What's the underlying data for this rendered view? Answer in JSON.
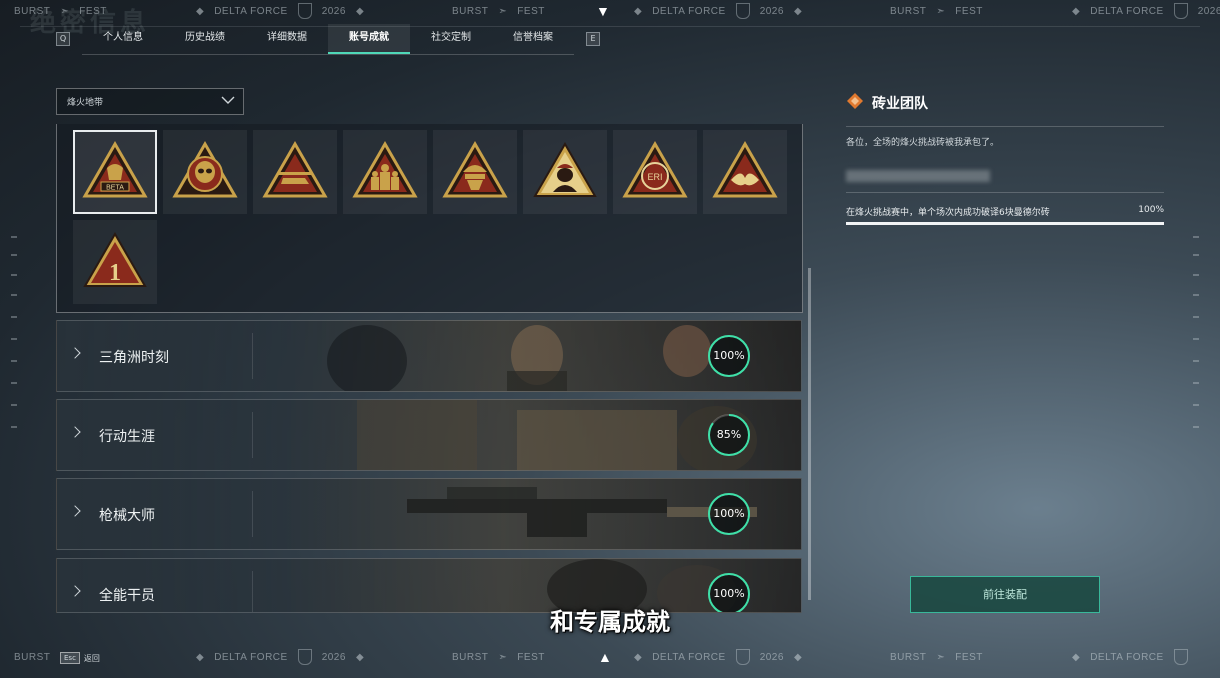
{
  "banner": {
    "burst": "BURST",
    "fest": "FEST",
    "delta_force": "DELTA FORCE",
    "year": "2026"
  },
  "watermark": "绝密信息",
  "tabs": {
    "left_key": "Q",
    "right_key": "E",
    "items": [
      "个人信息",
      "历史战绩",
      "详细数据",
      "账号成就",
      "社交定制",
      "信誉档案"
    ],
    "active_index": 3
  },
  "filter": {
    "selected": "烽火地带"
  },
  "badges": {
    "selected_index": 0,
    "items": [
      {
        "icon": "beta-badge-icon",
        "label": "BETA"
      },
      {
        "icon": "skull-badge-icon"
      },
      {
        "icon": "helicopter-badge-icon"
      },
      {
        "icon": "squad-badge-icon"
      },
      {
        "icon": "operator-helmet-badge-icon"
      },
      {
        "icon": "soldier-badge-icon"
      },
      {
        "icon": "eri-globe-badge-icon",
        "label": "ERI"
      },
      {
        "icon": "wings-badge-icon"
      },
      {
        "icon": "rank-one-badge-icon",
        "label": "1"
      }
    ]
  },
  "categories": [
    {
      "name": "三角洲时刻",
      "percent_label": "100%",
      "progress": 1.0
    },
    {
      "name": "行动生涯",
      "percent_label": "85%",
      "progress": 0.85
    },
    {
      "name": "枪械大师",
      "percent_label": "100%",
      "progress": 1.0
    },
    {
      "name": "全能干员",
      "percent_label": "100%",
      "progress": 1.0
    }
  ],
  "detail": {
    "title": "砖业团队",
    "description": "各位，全场的烽火挑战砖被我承包了。",
    "requirement": "在烽火挑战赛中，单个场次内成功破译6块曼德尔砖",
    "requirement_percent_label": "100%",
    "requirement_progress": 1.0
  },
  "equip_button": "前往装配",
  "subtitle": "和专属成就",
  "esc_hint": {
    "key": "Esc",
    "label": "返回"
  },
  "colors": {
    "accent": "#4fd8b8",
    "ring": "#3ee0a8",
    "gold": "#c9a24a",
    "badge_red": "#8a2a1c"
  }
}
